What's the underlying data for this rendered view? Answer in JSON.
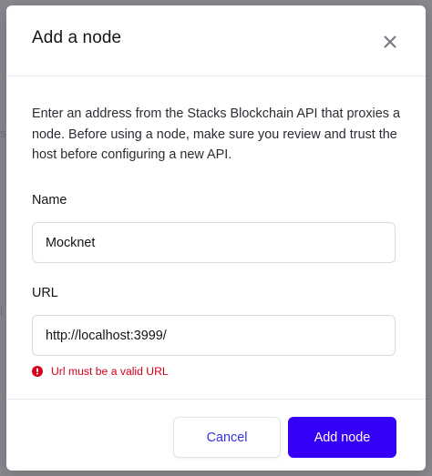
{
  "dialog": {
    "title": "Add a node",
    "close_icon": "close-icon",
    "description": "Enter an address from the Stacks Blockchain API that proxies a node. Before using a node, make sure you review and trust the host before configuring a new API.",
    "name_field": {
      "label": "Name",
      "value": "Mocknet"
    },
    "url_field": {
      "label": "URL",
      "value": "http://localhost:3999/",
      "error_icon": "error-circle-icon",
      "error": "Url must be a valid URL"
    },
    "buttons": {
      "cancel": "Cancel",
      "submit": "Add node"
    }
  },
  "background": {
    "partial_glyphs": [
      "s",
      "i"
    ]
  },
  "colors": {
    "primary": "#3700f6",
    "error": "#d4001a",
    "overlay": "#24252f"
  }
}
